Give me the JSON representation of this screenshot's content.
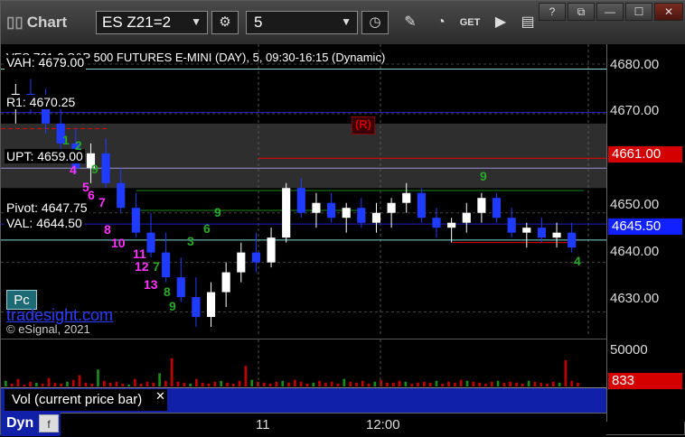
{
  "app": {
    "title": "Chart"
  },
  "toolbar": {
    "symbol": "ES Z21=2",
    "interval": "5"
  },
  "chart": {
    "header": "VES Z21-2  S&P 500 FUTURES E-MINI (DAY), 5, 09:30-16:15 (Dynamic)",
    "levels": {
      "vah": "VAH: 4679.00",
      "r1": "R1: 4670.25",
      "upt": "UPT: 4659.00",
      "pivot": "Pivot: 4647.75",
      "val": "VAL: 4644.50"
    },
    "price_axis": [
      "4680.00",
      "4670.00",
      "4650.00",
      "4640.00",
      "4630.00"
    ],
    "flags": {
      "target": "4661.00",
      "last": "4645.50"
    },
    "r_marker": "(R)",
    "sequence_magenta": [
      "4",
      "5",
      "6",
      "7",
      "8",
      "10",
      "11",
      "12",
      "13"
    ],
    "sequence_green": [
      "1",
      "2",
      "3",
      "4",
      "5",
      "6",
      "7",
      "8",
      "9"
    ],
    "pc_button": "Pc",
    "brand": "tradesight.com",
    "copyright": "© eSignal, 2021"
  },
  "volume": {
    "axis_label": "50000",
    "last_flag": "833",
    "study_label": "Vol (current price bar)",
    "close_glyph": "✕"
  },
  "timeaxis": {
    "panel_label": "Dyn",
    "ticks": [
      "11",
      "12:00"
    ]
  },
  "window_controls": [
    "?",
    "⧉",
    "—",
    "☐",
    "✕"
  ],
  "colors": {
    "up_bar": "#ffffff",
    "down_bar": "#1f3bff",
    "vol_bar": "#c00000",
    "last_flag": "#1020ff",
    "target_flag": "#d40000"
  },
  "chart_data": {
    "type": "candlestick",
    "ylim": [
      4625,
      4684
    ],
    "bars": [
      [
        4672,
        4676,
        4668,
        4674
      ],
      [
        4674,
        4677,
        4670,
        4671
      ],
      [
        4671,
        4675,
        4666,
        4668
      ],
      [
        4668,
        4671,
        4662,
        4664
      ],
      [
        4664,
        4667,
        4658,
        4659
      ],
      [
        4659,
        4664,
        4656,
        4662
      ],
      [
        4662,
        4665,
        4655,
        4656
      ],
      [
        4656,
        4659,
        4650,
        4651
      ],
      [
        4651,
        4654,
        4645,
        4646
      ],
      [
        4646,
        4650,
        4641,
        4642
      ],
      [
        4642,
        4646,
        4636,
        4637
      ],
      [
        4637,
        4641,
        4632,
        4633
      ],
      [
        4633,
        4637,
        4627,
        4629
      ],
      [
        4629,
        4636,
        4627,
        4634
      ],
      [
        4634,
        4640,
        4631,
        4638
      ],
      [
        4638,
        4644,
        4636,
        4642
      ],
      [
        4642,
        4646,
        4638,
        4640
      ],
      [
        4640,
        4647,
        4639,
        4645
      ],
      [
        4645,
        4656,
        4644,
        4655
      ],
      [
        4655,
        4657,
        4649,
        4650
      ],
      [
        4650,
        4654,
        4647,
        4652
      ],
      [
        4652,
        4654,
        4648,
        4649
      ],
      [
        4649,
        4652,
        4646,
        4651
      ],
      [
        4651,
        4653,
        4647,
        4648
      ],
      [
        4648,
        4652,
        4646,
        4650
      ],
      [
        4650,
        4653,
        4647,
        4652
      ],
      [
        4652,
        4656,
        4650,
        4654
      ],
      [
        4654,
        4655,
        4648,
        4649
      ],
      [
        4649,
        4651,
        4645,
        4647
      ],
      [
        4647,
        4649,
        4644,
        4648
      ],
      [
        4648,
        4652,
        4646,
        4650
      ],
      [
        4650,
        4654,
        4648,
        4653
      ],
      [
        4653,
        4654,
        4648,
        4649
      ],
      [
        4649,
        4651,
        4645,
        4646
      ],
      [
        4646,
        4648,
        4643,
        4647
      ],
      [
        4647,
        4649,
        4644,
        4645
      ],
      [
        4645,
        4648,
        4643,
        4646
      ],
      [
        4646,
        4648,
        4642,
        4643
      ]
    ]
  }
}
